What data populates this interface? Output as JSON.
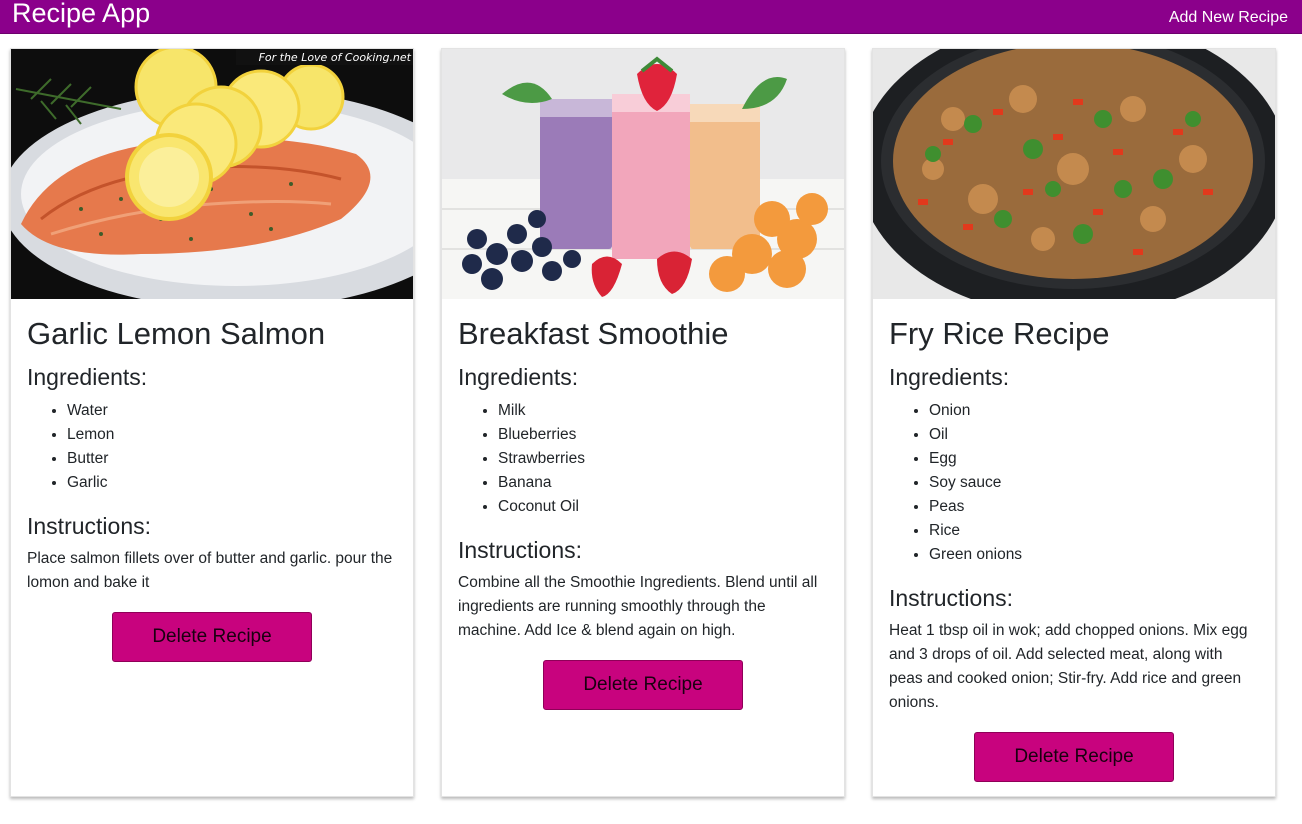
{
  "navbar": {
    "brand": "Recipe App",
    "add_link": "Add New Recipe",
    "background": "#8b008b"
  },
  "colors": {
    "delete_button": "#c8037e"
  },
  "labels": {
    "ingredients": "Ingredients:",
    "instructions": "Instructions:",
    "delete": "Delete Recipe"
  },
  "recipes": [
    {
      "title": "Garlic Lemon Salmon",
      "image": "salmon-with-lemon-slices-photo",
      "image_watermark": "For the Love of Cooking.net",
      "ingredients": [
        "Water",
        "Lemon",
        "Butter",
        "Garlic"
      ],
      "instructions": "Place salmon fillets over of butter and garlic. pour the lomon and bake it"
    },
    {
      "title": "Breakfast Smoothie",
      "image": "smoothies-with-berries-photo",
      "ingredients": [
        "Milk",
        "Blueberries",
        "Strawberries",
        "Banana",
        "Coconut Oil"
      ],
      "instructions": "Combine all the Smoothie Ingredients. Blend until all ingredients are running smoothly through the machine. Add Ice & blend again on high."
    },
    {
      "title": "Fry Rice Recipe",
      "image": "fried-rice-in-pan-photo",
      "ingredients": [
        "Onion",
        "Oil",
        "Egg",
        "Soy sauce",
        "Peas",
        "Rice",
        "Green onions"
      ],
      "instructions": "Heat 1 tbsp oil in wok; add chopped onions. Mix egg and 3 drops of oil. Add selected meat, along with peas and cooked onion; Stir-fry. Add rice and green onions."
    }
  ]
}
